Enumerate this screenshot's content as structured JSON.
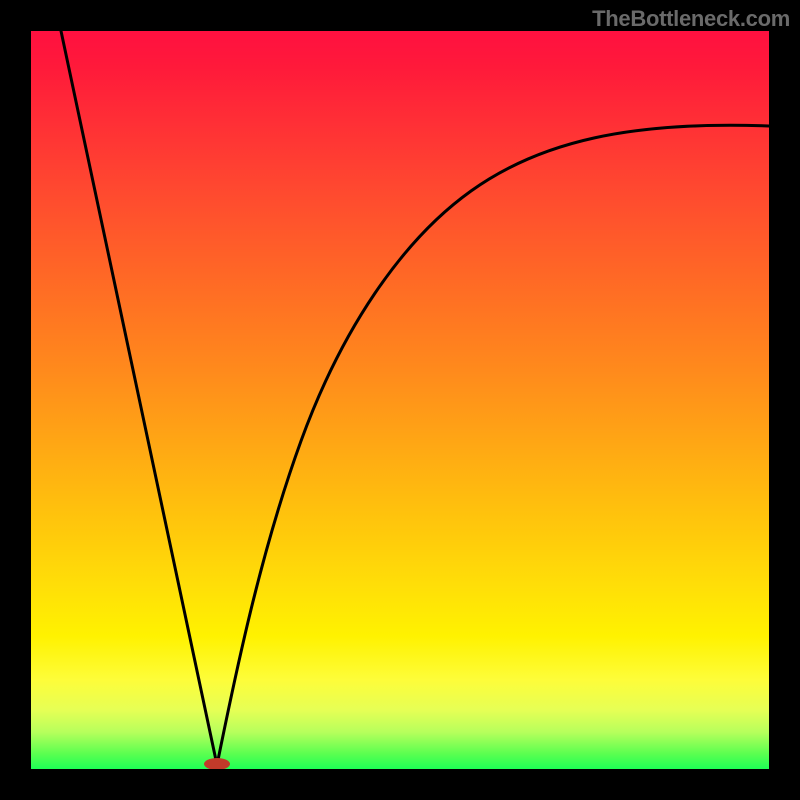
{
  "watermark": {
    "text": "TheBottleneck.com"
  },
  "chart_data": {
    "type": "line",
    "title": "",
    "xlabel": "",
    "ylabel": "",
    "xlim": [
      0,
      100
    ],
    "ylim": [
      0,
      100
    ],
    "grid": false,
    "legend": false,
    "annotations": [],
    "marker": {
      "x": 25,
      "y": 0,
      "color": "#c23a2a"
    },
    "series": [
      {
        "name": "left-arm",
        "x": [
          4,
          25
        ],
        "y": [
          100,
          0
        ]
      },
      {
        "name": "right-arm",
        "x": [
          25,
          27,
          30,
          33,
          37,
          41,
          46,
          52,
          58,
          65,
          73,
          82,
          90,
          100
        ],
        "y": [
          0,
          8,
          18,
          27,
          36,
          44,
          52,
          59,
          65,
          71,
          76,
          81,
          84,
          87
        ]
      }
    ],
    "gradient_stops": [
      {
        "pos": 0,
        "color": "#ff1040"
      },
      {
        "pos": 22,
        "color": "#ff4a2f"
      },
      {
        "pos": 46,
        "color": "#ff8a1c"
      },
      {
        "pos": 66,
        "color": "#ffc40c"
      },
      {
        "pos": 82,
        "color": "#fff200"
      },
      {
        "pos": 95,
        "color": "#b7ff5c"
      },
      {
        "pos": 100,
        "color": "#1eff55"
      }
    ]
  }
}
